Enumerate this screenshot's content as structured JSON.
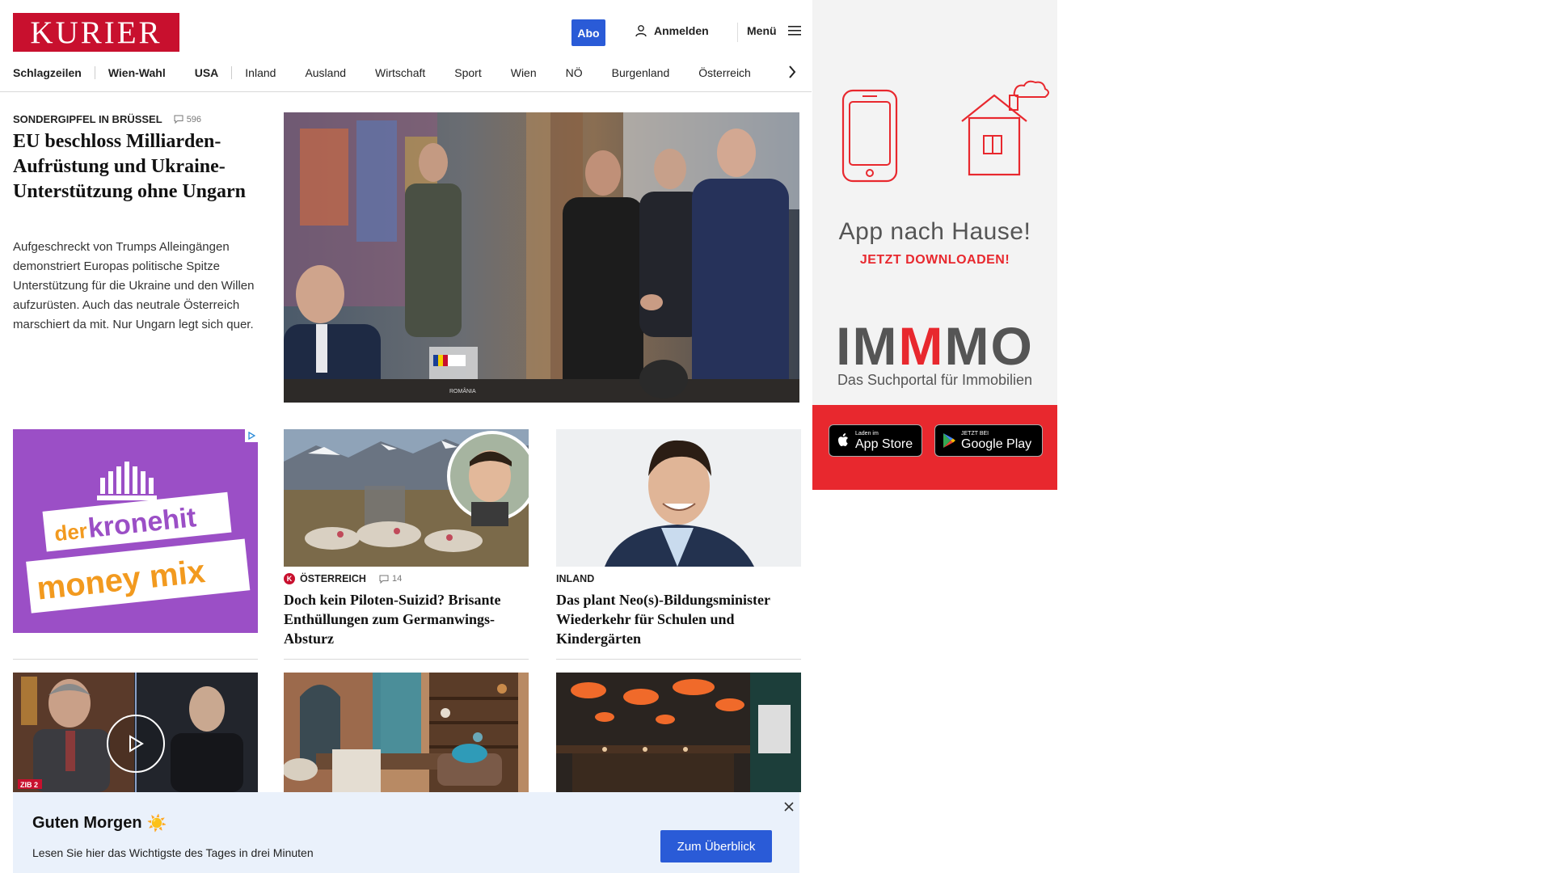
{
  "header": {
    "logo": "KURIER",
    "abo": "Abo",
    "login": "Anmelden",
    "menu": "Menü"
  },
  "nav": [
    "Schlagzeilen",
    "Wien-Wahl",
    "USA",
    "Inland",
    "Ausland",
    "Wirtschaft",
    "Sport",
    "Wien",
    "NÖ",
    "Burgenland",
    "Österreich"
  ],
  "lead": {
    "kicker": "SONDERGIPFEL IN BRÜSSEL",
    "comments": "596",
    "title": "EU beschloss Milliarden-Aufrüstung und Ukraine-Unterstützung ohne Ungarn",
    "text": "Aufgeschreckt von Trumps Alleingängen demonstriert Europas politische Spitze Unterstützung für die Ukraine und den Willen aufzurüsten. Auch das neutrale Österreich marschiert da mit. Nur Ungarn legt sich quer.",
    "image_caption": "ROMÂNIA"
  },
  "ad_left": {
    "line1": "der",
    "line2": "kronehit",
    "line3": "money mix"
  },
  "cards": [
    {
      "kicker": "ÖSTERREICH",
      "badge": "K",
      "comments": "14",
      "title": "Doch kein Piloten-Suizid? Brisante Enthüllungen zum Germanwings-Absturz"
    },
    {
      "kicker": "INLAND",
      "title": "Das plant Neo(s)-Bildungsminister Wiederkehr für Schulen und Kindergärten"
    }
  ],
  "video_tag": "ZIB 2",
  "side_ad": {
    "headline": "App nach Hause!",
    "cta": "JETZT DOWNLOADEN!",
    "brand_a": "IM",
    "brand_b": "M",
    "brand_c": "MO",
    "tagline": "Das Suchportal für Immobilien",
    "appstore_small": "Laden im",
    "appstore_big": "App Store",
    "googleplay_small": "JETZT BEI",
    "googleplay_big": "Google Play"
  },
  "banner": {
    "title": "Guten Morgen",
    "emoji": "☀️",
    "text": "Lesen Sie hier das Wichtigste des Tages in drei Minuten",
    "button": "Zum Überblick"
  },
  "colors": {
    "brand_red": "#c8102e",
    "accent_blue": "#2a5bd7",
    "immo_red": "#e8282e",
    "banner_bg": "#eaf1fb"
  }
}
